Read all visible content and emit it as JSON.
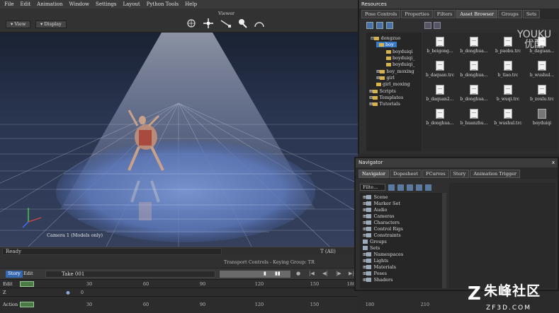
{
  "menu": [
    "File",
    "Edit",
    "Animation",
    "Window",
    "Settings",
    "Layout",
    "Python Tools",
    "Help"
  ],
  "viewer": {
    "title": "Viewer",
    "view_label": "View",
    "display_label": "Display",
    "camera_label": "Camera 1 (Models only)"
  },
  "status": {
    "ready": "Ready",
    "filter": "T (All)"
  },
  "transport": {
    "title": "Transport Controls  -  Keying Group: TR",
    "story_label": "Story",
    "edit_label": "Edit",
    "take": "Take 001"
  },
  "timeline": {
    "rows": [
      {
        "label": "Edit",
        "ticks": [
          "30",
          "60",
          "90",
          "120",
          "150",
          "180"
        ]
      },
      {
        "label": "Z",
        "ticks": [
          "0"
        ]
      },
      {
        "label": "Action",
        "ticks": [
          "30",
          "60",
          "90",
          "120",
          "150",
          "180",
          "210"
        ]
      }
    ]
  },
  "resources": {
    "title": "Resources",
    "tabs": [
      "Pose Controls",
      "Properties",
      "Filters",
      "Asset Browser",
      "Groups",
      "Sets"
    ],
    "active_tab": "Asset Browser",
    "tree": [
      {
        "label": "dongzuo",
        "depth": 0
      },
      {
        "label": "boy",
        "depth": 1,
        "selected": true
      },
      {
        "label": "boyduiqi",
        "depth": 2
      },
      {
        "label": "boyduiqi_",
        "depth": 2
      },
      {
        "label": "boyduiqi_",
        "depth": 2
      },
      {
        "label": "boy_moxing",
        "depth": 1
      },
      {
        "label": "girl",
        "depth": 1
      },
      {
        "label": "girl_moxing",
        "depth": 1
      },
      {
        "label": "Scripts",
        "depth": 0
      },
      {
        "label": "Templates",
        "depth": 0
      },
      {
        "label": "Tutorials",
        "depth": 0
      }
    ],
    "files": [
      "b_beigong...",
      "b_donghua...",
      "b_paobu.trc",
      "b_daguan...",
      "b_daquan.trc",
      "b_donghua...",
      "b_tiao.trc",
      "b_wushul...",
      "b_daquan2...",
      "b_donghua...",
      "b_wuqi.trc",
      "b_zoulu.trc",
      "b_donghua...",
      "b_huanzhu...",
      "b_wushul.trc",
      "boyduiqi"
    ]
  },
  "navigator": {
    "title": "Navigator",
    "close": "x",
    "tabs": [
      "Navigator",
      "Dopesheet",
      "FCurves",
      "Story",
      "Animation Trigger"
    ],
    "active_tab": "Navigator",
    "filter": "Filte...",
    "items": [
      "Scene",
      "Marker Set",
      "Audio",
      "Cameras",
      "Characters",
      "Control Rigs",
      "Constraints",
      "Groups",
      "Sets",
      "Namespaces",
      "Lights",
      "Materials",
      "Poses",
      "Shaders"
    ]
  },
  "watermarks": {
    "youku_en": "YOUKU",
    "youku_cn": "优酷",
    "site_cn": "朱峰社区",
    "site_en": "ZF3D.COM"
  }
}
